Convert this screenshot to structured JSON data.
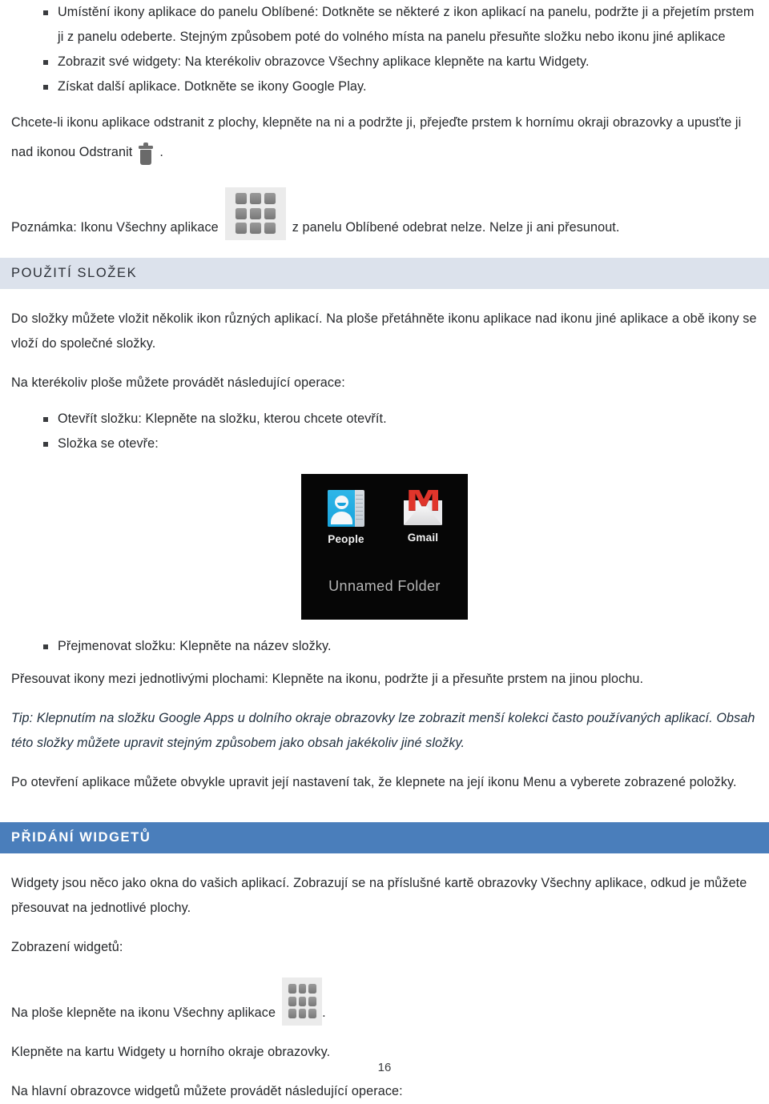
{
  "document": {
    "page_number": "16",
    "language": "cs"
  },
  "colors": {
    "text": "#26282b",
    "heading_light_bg": "#dce2ec",
    "heading_blue_bg": "#4a7ebb",
    "heading_blue_text": "#ffffff",
    "tip_text": "#21303f",
    "screenshot_bg": "#060606"
  },
  "top_bullets": [
    "Umístění ikony aplikace do panelu Oblíbené: Dotkněte se některé z ikon aplikací na panelu, podržte ji a přejetím prstem ji z panelu odeberte. Stejným způsobem poté do volného místa na panelu přesuňte složku nebo ikonu jiné aplikace",
    "Zobrazit své widgety: Na kterékoliv obrazovce Všechny aplikace klepněte na kartu Widgety.",
    "Získat další aplikace. Dotkněte se ikony Google Play."
  ],
  "remove_paragraph": {
    "line1": "Chcete-li ikonu aplikace odstranit z plochy, klepněte na ni a podržte ji, přejeďte prstem k hornímu okraji obrazovky a upusťte ji",
    "line2_before_icon": "nad ikonou Odstranit",
    "line2_after_icon": ".",
    "icon": "trash-icon"
  },
  "note": {
    "before_icon": "Poznámka: Ikonu Všechny aplikace",
    "icon": "all-apps-grid-icon",
    "after_icon": "z panelu Oblíbené odebrat nelze. Nelze ji ani přesunout."
  },
  "folders_section": {
    "heading": "POUŽITÍ SLOŽEK",
    "intro_paragraph": "Do složky můžete vložit několik ikon různých aplikací. Na ploše přetáhněte ikonu aplikace nad ikonu jiné aplikace a obě ikony se vloží do společné složky.",
    "operations_lead": "Na kterékoliv ploše můžete provádět následující operace:",
    "bullets_before_image": [
      "Otevřít složku: Klepněte na složku, kterou chcete otevřít.",
      "Složka se otevře:"
    ],
    "bullets_after_image": [
      "Přejmenovat složku: Klepněte na název složky."
    ],
    "move_paragraph": "Přesouvat ikony mezi jednotlivými plochami: Klepněte na ikonu, podržte ji a přesuňte prstem na jinou plochu.",
    "tip_paragraph": "Tip: Klepnutím na složku Google Apps u dolního okraje obrazovky lze zobrazit menší kolekci často používaných aplikací. Obsah této složky můžete upravit stejným způsobem jako obsah jakékoliv jiné složky.",
    "menu_paragraph": "Po otevření aplikace můžete obvykle upravit její nastavení tak, že klepnete na její ikonu Menu a vyberete zobrazené položky."
  },
  "folder_screenshot": {
    "apps": [
      {
        "label": "People",
        "icon": "people-contacts-icon"
      },
      {
        "label": "Gmail",
        "icon": "gmail-envelope-icon"
      }
    ],
    "folder_name": "Unnamed Folder",
    "gmail_letter": "M"
  },
  "widgets_section": {
    "heading": "PŘIDÁNÍ WIDGETŮ",
    "intro_paragraph": "Widgety jsou něco jako okna do vašich aplikací. Zobrazují se na příslušné kartě obrazovky Všechny aplikace, odkud je můžete přesouvat na jednotlivé plochy.",
    "display_lead": "Zobrazení widgetů:",
    "step_tap_before_icon": "Na ploše klepněte na ikonu Všechny aplikace",
    "step_tap_icon": "all-apps-grid-icon",
    "step_tap_after_icon": ".",
    "step_widgets_tab": "Klepněte na kartu Widgety u horního okraje obrazovky.",
    "operations_lead": "Na hlavní obrazovce widgetů můžete provádět následující operace:"
  }
}
